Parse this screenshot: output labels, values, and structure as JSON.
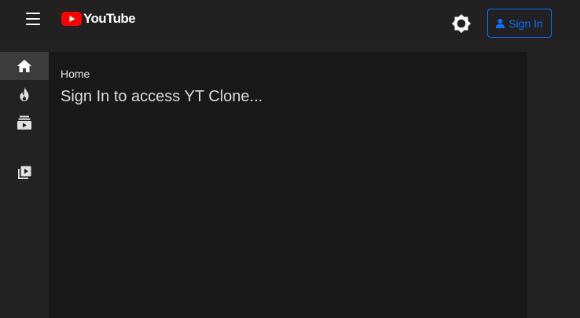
{
  "header": {
    "logo_text": "YouTube",
    "sign_in_label": "Sign In"
  },
  "icons": {
    "menu": "hamburger-menu-icon",
    "theme": "sun-icon",
    "user": "user-icon"
  },
  "sidebar": {
    "items": [
      {
        "name": "home",
        "icon": "home-icon",
        "active": true
      },
      {
        "name": "trending",
        "icon": "fire-icon",
        "active": false
      },
      {
        "name": "subscriptions",
        "icon": "subscriptions-icon",
        "active": false
      },
      {
        "name": "library",
        "icon": "library-icon",
        "active": false
      }
    ]
  },
  "main": {
    "breadcrumb": "Home",
    "message": "Sign In to access YT Clone..."
  },
  "colors": {
    "accent": "#0d6efd",
    "brand_red": "#ff0000",
    "header_bg": "#212121",
    "main_bg": "#181818"
  }
}
